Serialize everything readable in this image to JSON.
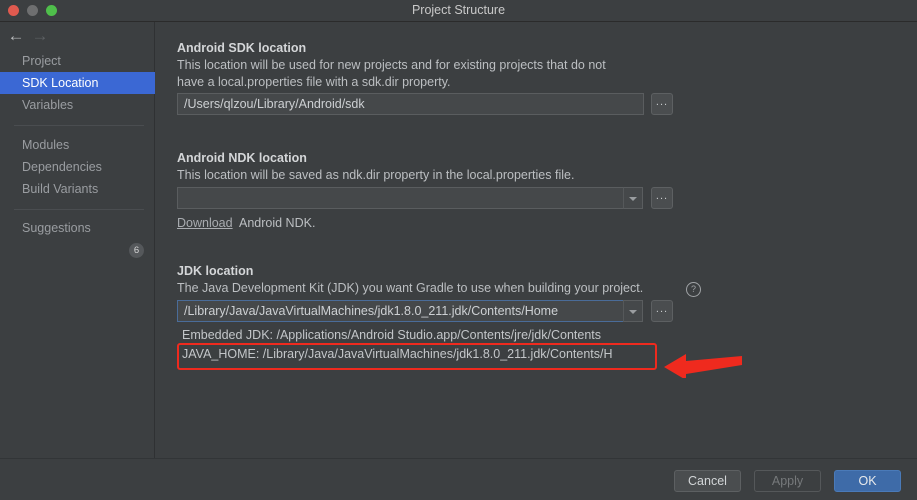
{
  "window": {
    "title": "Project Structure",
    "traffic_lights": {
      "close_color": "#e05a4f",
      "minimize_color": "#6e6f70",
      "maximize_color": "#4fbf4b"
    }
  },
  "nav": {
    "back_icon": "arrow-left-icon",
    "forward_icon": "arrow-right-icon",
    "back_glyph": "←",
    "forward_glyph": "→"
  },
  "sidebar": {
    "selected": "SDK Location",
    "items": [
      {
        "label": "Project"
      },
      {
        "label": "SDK Location"
      },
      {
        "label": "Variables"
      },
      {
        "label": "Modules"
      },
      {
        "label": "Dependencies"
      },
      {
        "label": "Build Variants"
      },
      {
        "label": "Suggestions",
        "badge": "6"
      }
    ]
  },
  "main": {
    "sdk": {
      "title": "Android SDK location",
      "desc_line1": "This location will be used for new projects and for existing projects that do not",
      "desc_line2": "have a local.properties file with a sdk.dir property.",
      "value": "/Users/qlzou/Library/Android/sdk",
      "browse_label": "..."
    },
    "ndk": {
      "title": "Android NDK location",
      "desc_line1": "This location will be saved as ndk.dir property in the local.properties file.",
      "value": "",
      "browse_label": "...",
      "download_link": "Download",
      "download_suffix": "Android NDK."
    },
    "jdk": {
      "title": "JDK location",
      "desc_line1": "The Java Development Kit (JDK) you want Gradle to use when building your project.",
      "help_icon": "help-circle-icon",
      "help_glyph": "?",
      "value": "/Library/Java/JavaVirtualMachines/jdk1.8.0_211.jdk/Contents/Home",
      "browse_label": "...",
      "embedded_jdk_line": "Embedded JDK: /Applications/Android Studio.app/Contents/jre/jdk/Contents",
      "java_home_line": "JAVA_HOME: /Library/Java/JavaVirtualMachines/jdk1.8.0_211.jdk/Contents/H"
    }
  },
  "annotation": {
    "highlight_color": "#ef2a1e",
    "arrow_color": "#ef2a1e",
    "arrow_icon": "arrow-left-annotation-icon"
  },
  "footer": {
    "cancel_label": "Cancel",
    "apply_label": "Apply",
    "ok_label": "OK",
    "accent_color": "#3e6ba8"
  }
}
